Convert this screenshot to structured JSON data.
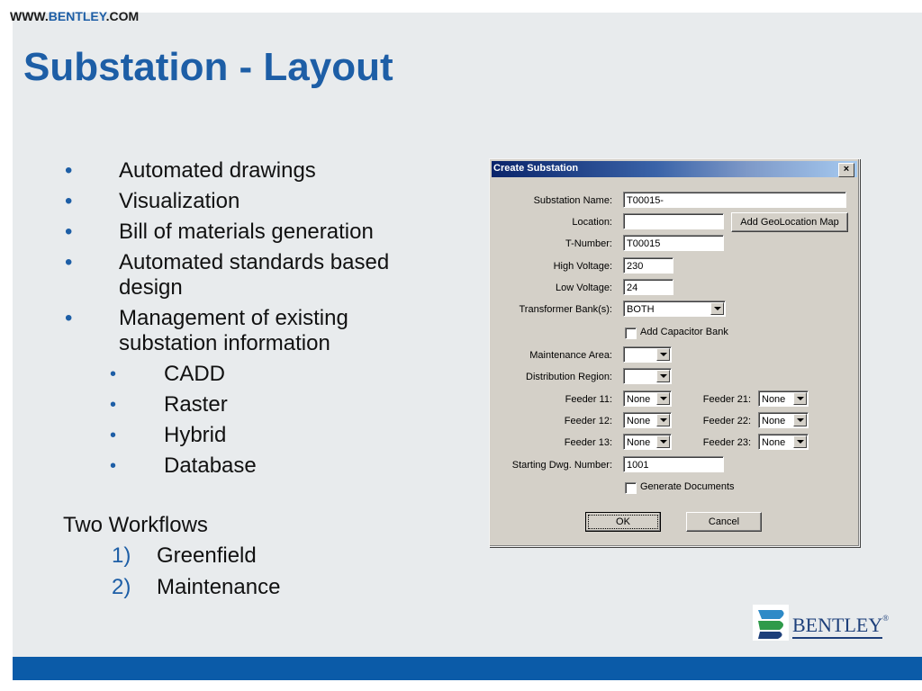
{
  "header": {
    "url_prefix": "WWW.",
    "url_brand": "BENTLEY",
    "url_suffix": ".COM",
    "title": "Substation - Layout"
  },
  "bullets": [
    {
      "text": "Automated drawings"
    },
    {
      "text": "Visualization"
    },
    {
      "text": "Bill of materials generation"
    },
    {
      "text": "Automated standards based design"
    },
    {
      "text": "Management of existing substation information"
    }
  ],
  "sub_bullets": [
    {
      "text": "CADD"
    },
    {
      "text": "Raster"
    },
    {
      "text": "Hybrid"
    },
    {
      "text": "Database"
    }
  ],
  "workflows": {
    "heading": "Two Workflows",
    "items": [
      {
        "num": "1)",
        "text": "Greenfield"
      },
      {
        "num": "2)",
        "text": "Maintenance"
      }
    ]
  },
  "dialog": {
    "title": "Create Substation",
    "close": "×",
    "substation_name": {
      "label": "Substation Name:",
      "value": "T00015-"
    },
    "location": {
      "label": "Location:",
      "value": "",
      "button": "Add GeoLocation Map"
    },
    "t_number": {
      "label": "T-Number:",
      "value": "T00015"
    },
    "high_voltage": {
      "label": "High Voltage:",
      "value": "230"
    },
    "low_voltage": {
      "label": "Low Voltage:",
      "value": "24"
    },
    "transformer_banks": {
      "label": "Transformer Bank(s):",
      "value": "BOTH"
    },
    "add_capacitor_bank": {
      "label": "Add Capacitor Bank",
      "checked": false
    },
    "maintenance_area": {
      "label": "Maintenance Area:",
      "value": ""
    },
    "distribution_region": {
      "label": "Distribution Region:",
      "value": ""
    },
    "feeders_left": [
      {
        "label": "Feeder 11:",
        "value": "None"
      },
      {
        "label": "Feeder 12:",
        "value": "None"
      },
      {
        "label": "Feeder 13:",
        "value": "None"
      }
    ],
    "feeders_right": [
      {
        "label": "Feeder 21:",
        "value": "None"
      },
      {
        "label": "Feeder 22:",
        "value": "None"
      },
      {
        "label": "Feeder 23:",
        "value": "None"
      }
    ],
    "starting_dwg": {
      "label": "Starting Dwg. Number:",
      "value": "1001"
    },
    "generate_documents": {
      "label": "Generate Documents",
      "checked": false
    },
    "ok": "OK",
    "cancel": "Cancel"
  },
  "logo": {
    "text": "BENTLEY",
    "reg": "®"
  },
  "colors": {
    "brand_blue": "#1d5ea6",
    "bottom_bar": "#0b5ba8",
    "dialog_face": "#d4d0c8"
  }
}
